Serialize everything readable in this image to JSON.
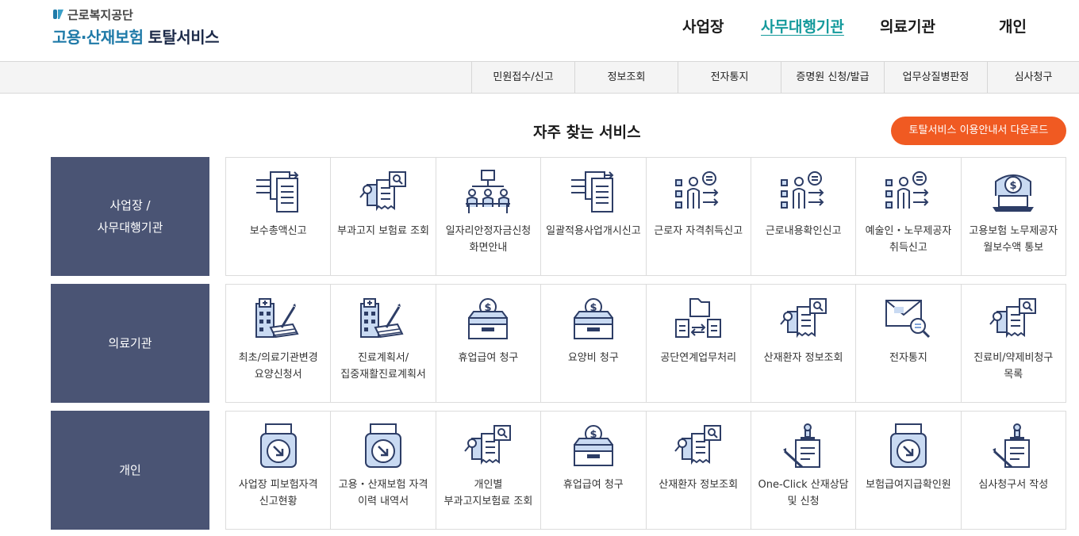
{
  "header": {
    "logo_org": "근로복지공단",
    "logo_part1": "고용·산재보험",
    "logo_part2": "토탈서비스",
    "nav": [
      {
        "label": "사업장",
        "active": false
      },
      {
        "label": "사무대행기관",
        "active": true
      },
      {
        "label": "의료기관",
        "active": false
      },
      {
        "label": "개인",
        "active": false
      }
    ],
    "accent_color": "#159a9c"
  },
  "subnav": [
    "민원접수/신고",
    "정보조회",
    "전자통지",
    "증명원 신청/발급",
    "업무상질병판정",
    "심사청구"
  ],
  "main": {
    "title": "자주 찾는 서비스",
    "guide_button": "토탈서비스 이용안내서 다운로드",
    "guide_button_color": "#f05a22"
  },
  "rows": [
    {
      "label": "사업장 /\n사무대행기관",
      "tiles": [
        {
          "label": "보수총액신고",
          "icon": "document-list-icon"
        },
        {
          "label": "부과고지 보험료 조회",
          "icon": "receipt-search-icon"
        },
        {
          "label": "일자리안정자금신청 화면안내",
          "icon": "organization-chart-icon"
        },
        {
          "label": "일괄적용사업개시신고",
          "icon": "document-list-icon"
        },
        {
          "label": "근로자 자격취득신고",
          "icon": "worker-checklist-icon"
        },
        {
          "label": "근로내용확인신고",
          "icon": "worker-checklist-icon"
        },
        {
          "label": "예술인・노무제공자 취득신고",
          "icon": "worker-checklist-icon"
        },
        {
          "label": "고용보험 노무제공자 월보수액 통보",
          "icon": "money-laptop-icon"
        }
      ]
    },
    {
      "label": "의료기관",
      "tiles": [
        {
          "label": "최초/의료기관변경 요양신청서",
          "icon": "hospital-document-icon"
        },
        {
          "label": "진료계획서/집중재활진료계획서",
          "icon": "hospital-document-icon"
        },
        {
          "label": "휴업급여 청구",
          "icon": "money-box-icon"
        },
        {
          "label": "요양비 청구",
          "icon": "money-box-icon"
        },
        {
          "label": "공단연계업무처리",
          "icon": "file-exchange-icon"
        },
        {
          "label": "산재환자 정보조회",
          "icon": "receipt-search-icon"
        },
        {
          "label": "전자통지",
          "icon": "mail-search-icon"
        },
        {
          "label": "진료비/약제비청구 목록",
          "icon": "receipt-search-icon"
        }
      ]
    },
    {
      "label": "개인",
      "tiles": [
        {
          "label": "사업장 피보험자격 신고현황",
          "icon": "printer-download-icon"
        },
        {
          "label": "고용・산재보험 자격 이력 내역서",
          "icon": "printer-download-icon"
        },
        {
          "label": "개인별 부과고지보험료 조회",
          "icon": "receipt-search-icon"
        },
        {
          "label": "휴업급여 청구",
          "icon": "money-box-icon"
        },
        {
          "label": "산재환자 정보조회",
          "icon": "receipt-search-icon"
        },
        {
          "label": "One-Click 산재상담 및 신청",
          "icon": "stamp-document-icon"
        },
        {
          "label": "보험급여지급확인원",
          "icon": "printer-download-icon"
        },
        {
          "label": "심사청구서 작성",
          "icon": "stamp-document-icon"
        }
      ]
    }
  ]
}
